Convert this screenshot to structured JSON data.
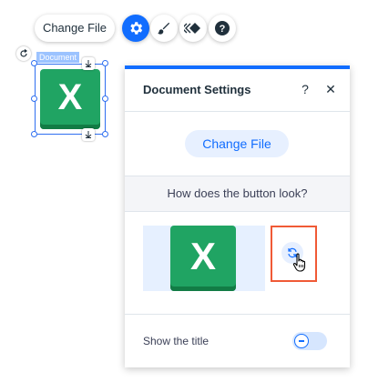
{
  "toolbar": {
    "change_file_label": "Change File",
    "icons": [
      "gear-icon",
      "paint-brush-icon",
      "animation-icon",
      "help-icon"
    ],
    "active_color": "#116dff"
  },
  "element": {
    "name_tag": "Document",
    "file_glyph": "X",
    "tile_color": "#20a463"
  },
  "panel": {
    "title": "Document Settings",
    "help_label": "?",
    "close_label": "✕",
    "change_file_label": "Change File",
    "design_question": "How does the button look?",
    "show_title_label": "Show the title",
    "show_title_enabled": false,
    "accent_color": "#116dff",
    "highlight_color": "#f05a36"
  }
}
